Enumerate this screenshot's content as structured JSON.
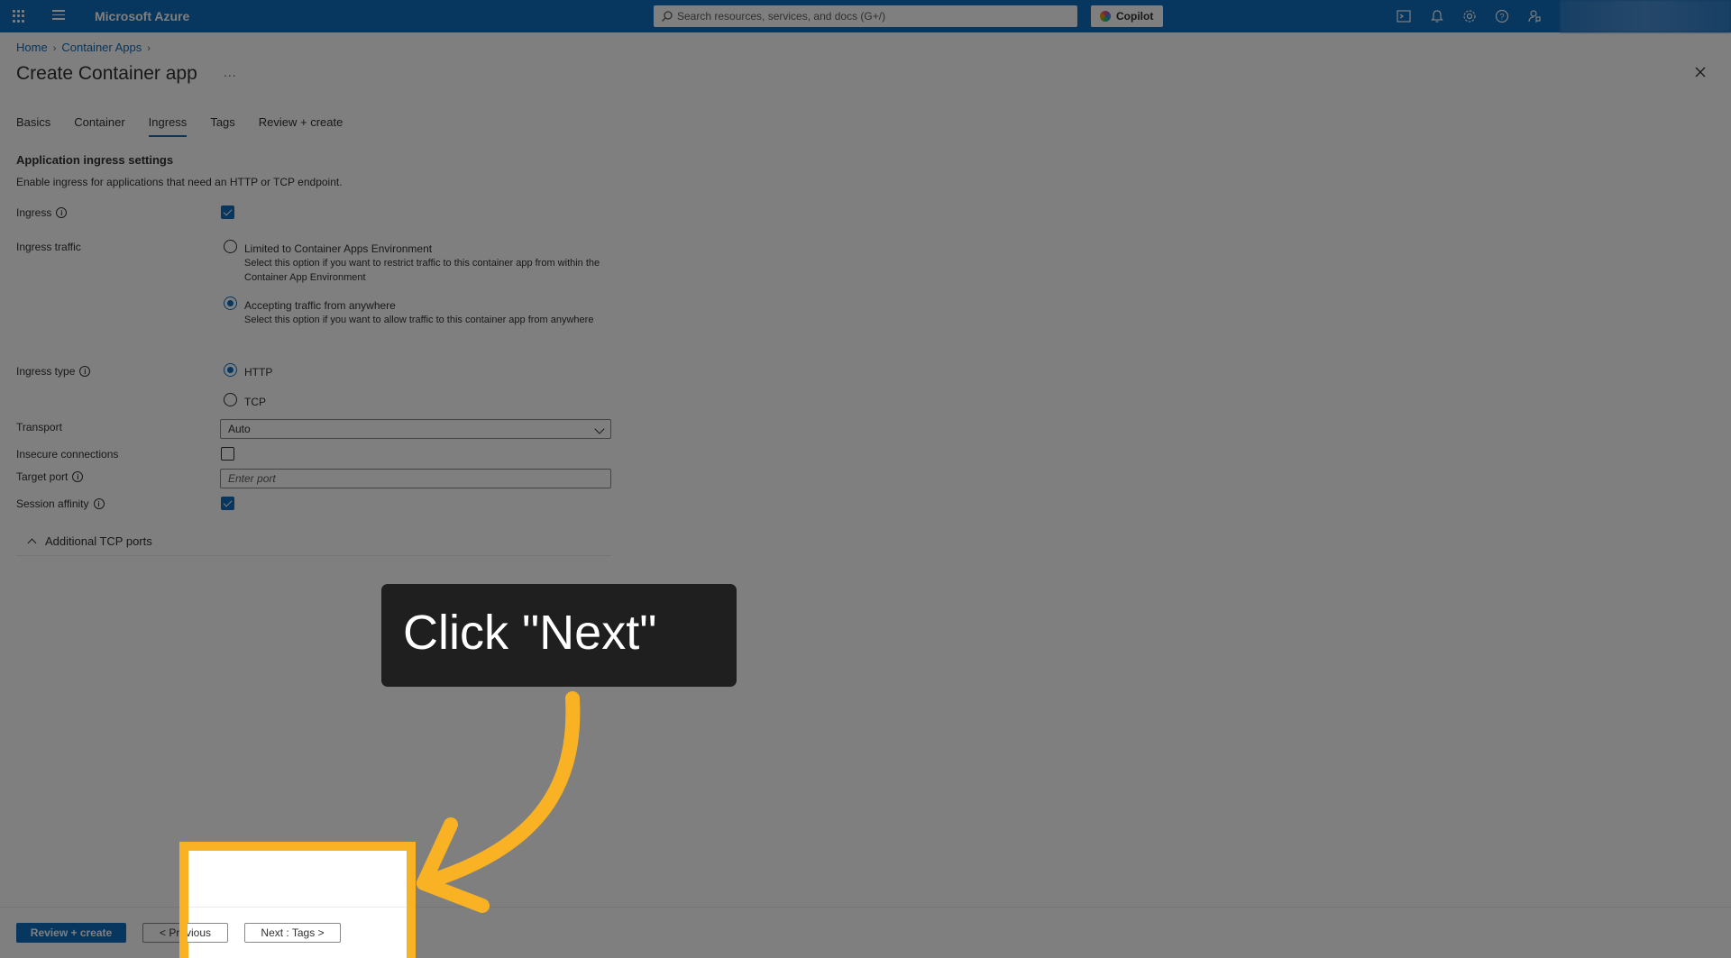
{
  "topbar": {
    "brand": "Microsoft Azure",
    "search_placeholder": "Search resources, services, and docs (G+/)",
    "copilot_label": "Copilot"
  },
  "breadcrumb": {
    "items": [
      "Home",
      "Container Apps"
    ]
  },
  "page": {
    "title": "Create Container app",
    "more": "..."
  },
  "tabs": [
    {
      "label": "Basics",
      "active": false
    },
    {
      "label": "Container",
      "active": false
    },
    {
      "label": "Ingress",
      "active": true
    },
    {
      "label": "Tags",
      "active": false
    },
    {
      "label": "Review + create",
      "active": false
    }
  ],
  "section": {
    "title": "Application ingress settings",
    "description": "Enable ingress for applications that need an HTTP or TCP endpoint."
  },
  "form": {
    "ingress_label": "Ingress",
    "ingress_checked": true,
    "traffic_label": "Ingress traffic",
    "traffic_options": [
      {
        "label": "Limited to Container Apps Environment",
        "desc": "Select this option if you want to restrict traffic to this container app from within the Container App Environment",
        "selected": false
      },
      {
        "label": "Accepting traffic from anywhere",
        "desc": "Select this option if you want to allow traffic to this container app from anywhere",
        "selected": true
      }
    ],
    "type_label": "Ingress type",
    "type_options": [
      {
        "label": "HTTP",
        "selected": true
      },
      {
        "label": "TCP",
        "selected": false
      }
    ],
    "transport_label": "Transport",
    "transport_value": "Auto",
    "insecure_label": "Insecure connections",
    "insecure_checked": false,
    "port_label": "Target port",
    "port_placeholder": "Enter port",
    "affinity_label": "Session affinity",
    "affinity_checked": true,
    "additional_ports_label": "Additional TCP ports"
  },
  "footer": {
    "review_create": "Review + create",
    "previous": "< Previous",
    "next": "Next : Tags >"
  },
  "overlay": {
    "callout_text": "Click \"Next\"",
    "highlight_color": "#f9b224"
  },
  "colors": {
    "accent": "#0f6cbd",
    "topbar": "#0f6cbd"
  }
}
